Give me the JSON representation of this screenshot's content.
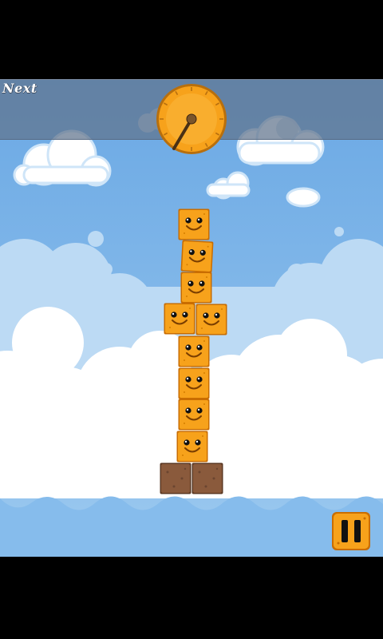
{
  "hud": {
    "next_label": "Next",
    "timer_level": 0.05
  },
  "tower": {
    "face_block_count": 9,
    "base_block_count": 2
  },
  "icons": {
    "pause": "pause-icon",
    "timer": "clock-icon",
    "block": "smiley-block-icon",
    "base": "dirt-block-icon"
  },
  "colors": {
    "sky": "#7fb6e8",
    "block_orange": "#f7a21b",
    "block_border": "#c96d00",
    "dirt": "#8a5a3c",
    "hud": "#5f738c"
  }
}
